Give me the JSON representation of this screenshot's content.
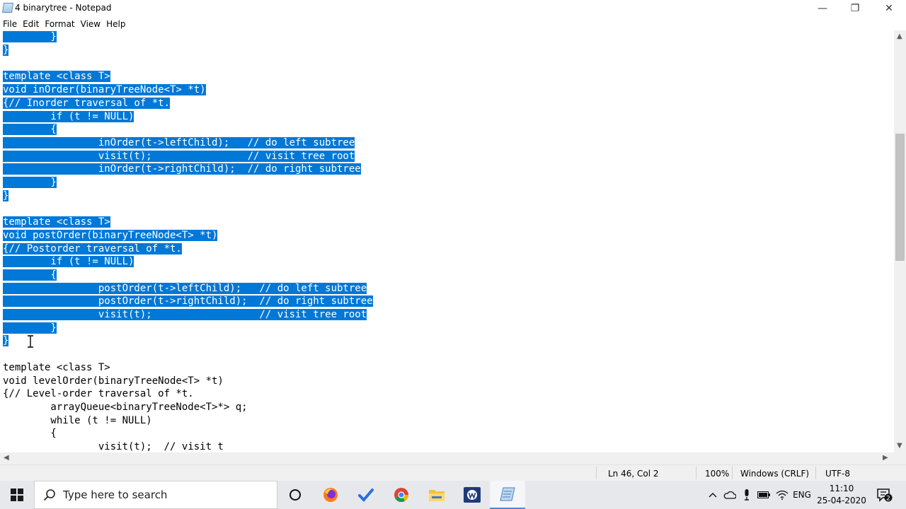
{
  "window": {
    "title": "4 binarytree - Notepad",
    "minimize_glyph": "—",
    "restore_glyph": "❐",
    "close_glyph": "✕"
  },
  "menu": [
    "File",
    "Edit",
    "Format",
    "View",
    "Help"
  ],
  "editor": {
    "lines": [
      {
        "text": "        }",
        "selected": true
      },
      {
        "text": "}",
        "selected": true
      },
      {
        "text": "",
        "selected": false
      },
      {
        "text": "template <class T>",
        "selected": true
      },
      {
        "text": "void inOrder(binaryTreeNode<T> *t)",
        "selected": true
      },
      {
        "text": "{// Inorder traversal of *t.",
        "selected": true
      },
      {
        "text": "        if (t != NULL)",
        "selected": true
      },
      {
        "text": "        {",
        "selected": true
      },
      {
        "text": "                inOrder(t->leftChild);   // do left subtree",
        "selected": true
      },
      {
        "text": "                visit(t);                // visit tree root",
        "selected": true
      },
      {
        "text": "                inOrder(t->rightChild);  // do right subtree",
        "selected": true
      },
      {
        "text": "        }",
        "selected": true
      },
      {
        "text": "}",
        "selected": true
      },
      {
        "text": "",
        "selected": false
      },
      {
        "text": "template <class T>",
        "selected": true
      },
      {
        "text": "void postOrder(binaryTreeNode<T> *t)",
        "selected": true
      },
      {
        "text": "{// Postorder traversal of *t.",
        "selected": true
      },
      {
        "text": "        if (t != NULL)",
        "selected": true
      },
      {
        "text": "        {",
        "selected": true
      },
      {
        "text": "                postOrder(t->leftChild);   // do left subtree",
        "selected": true
      },
      {
        "text": "                postOrder(t->rightChild);  // do right subtree",
        "selected": true
      },
      {
        "text": "                visit(t);                  // visit tree root",
        "selected": true
      },
      {
        "text": "        }",
        "selected": true
      },
      {
        "text": "}",
        "selected": true
      },
      {
        "text": "",
        "selected": false
      },
      {
        "text": "template <class T>",
        "selected": false
      },
      {
        "text": "void levelOrder(binaryTreeNode<T> *t)",
        "selected": false
      },
      {
        "text": "{// Level-order traversal of *t.",
        "selected": false
      },
      {
        "text": "        arrayQueue<binaryTreeNode<T>*> q;",
        "selected": false
      },
      {
        "text": "        while (t != NULL)",
        "selected": false
      },
      {
        "text": "        {",
        "selected": false
      },
      {
        "text": "                visit(t);  // visit t",
        "selected": false
      }
    ]
  },
  "status": {
    "position": "Ln 46, Col 2",
    "zoom": "100%",
    "line_ending": "Windows (CRLF)",
    "encoding": "UTF-8"
  },
  "taskbar": {
    "search_placeholder": "Type here to search",
    "language": "ENG",
    "time": "11:10",
    "date": "25-04-2020",
    "notification_count": "2"
  },
  "colors": {
    "selection": "#0078d7",
    "taskbar": "#e6e8ec"
  }
}
